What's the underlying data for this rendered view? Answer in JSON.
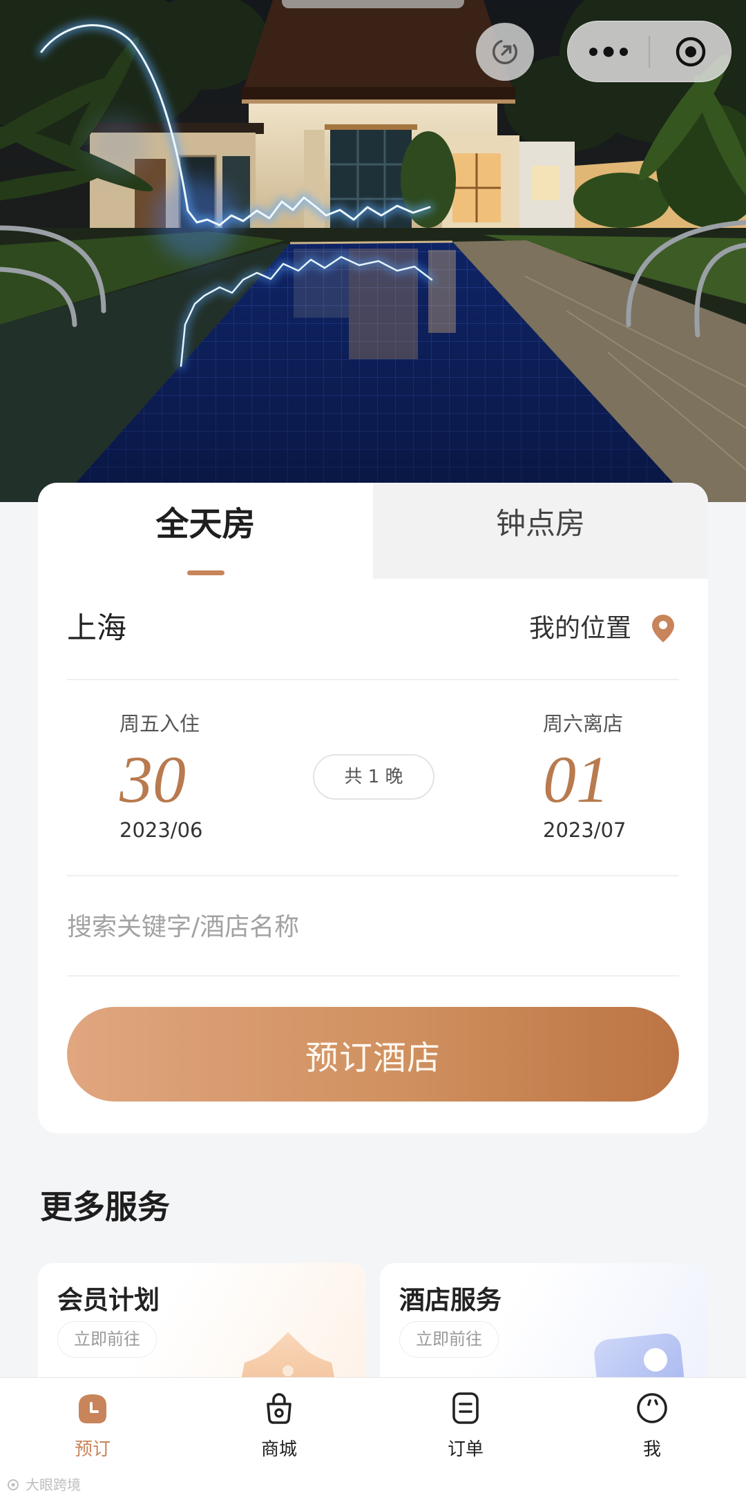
{
  "top_actions": {
    "refresh_icon": "refresh-icon",
    "more_icon": "more-icon",
    "close_icon": "close-icon"
  },
  "booking": {
    "tabs": [
      {
        "label": "全天房",
        "active": true
      },
      {
        "label": "钟点房",
        "active": false
      }
    ],
    "city": "上海",
    "location_label": "我的位置",
    "location_icon": "location-pin-icon",
    "checkin": {
      "weekday_label": "周五入住",
      "day": "30",
      "month": "2023/06"
    },
    "nights_label": "共 1 晚",
    "checkout": {
      "weekday_label": "周六离店",
      "day": "01",
      "month": "2023/07"
    },
    "search": {
      "placeholder": "搜索关键字/酒店名称"
    },
    "submit_label": "预订酒店"
  },
  "services": {
    "heading": "更多服务",
    "items": [
      {
        "title": "会员计划",
        "action": "立即前往",
        "icon": "crown-icon"
      },
      {
        "title": "酒店服务",
        "action": "立即前往",
        "icon": "card-icon"
      }
    ]
  },
  "tabbar": {
    "items": [
      {
        "label": "预订",
        "icon": "booking-clock-icon",
        "active": true
      },
      {
        "label": "商城",
        "icon": "shopping-bag-icon",
        "active": false
      },
      {
        "label": "订单",
        "icon": "order-document-icon",
        "active": false
      },
      {
        "label": "我",
        "icon": "profile-face-icon",
        "active": false
      }
    ]
  },
  "colors": {
    "accent": "#c8845a",
    "button_start": "#e0a67f",
    "button_end": "#bc7444",
    "date_number": "#b87a4e",
    "page_background": "#f4f5f7"
  },
  "watermark": {
    "text": "大眼跨境"
  }
}
